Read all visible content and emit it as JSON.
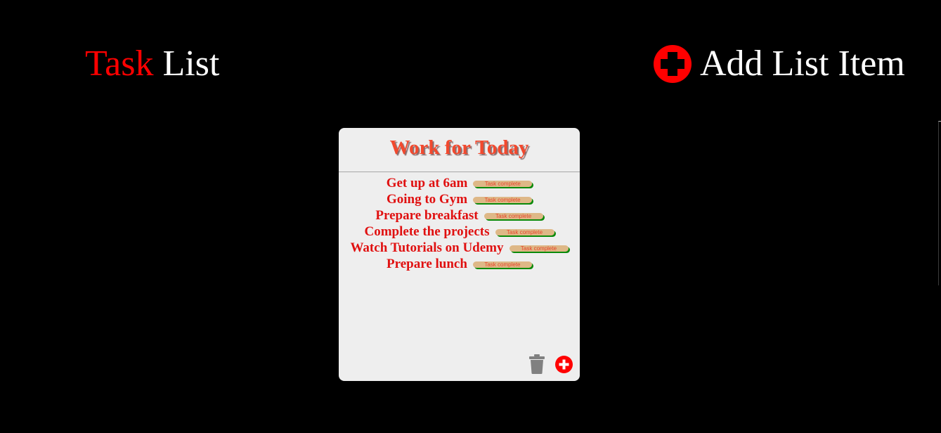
{
  "header": {
    "title_accent": "Task",
    "title_rest": "List",
    "add_list_label": "Add List Item",
    "add_list_icon": "plus-circle-icon"
  },
  "card": {
    "title": "Work for Today",
    "tasks": [
      {
        "text": "Get up at 6am",
        "button_label": "Task complete"
      },
      {
        "text": "Going to Gym",
        "button_label": "Task complete"
      },
      {
        "text": "Prepare breakfast",
        "button_label": "Task complete"
      },
      {
        "text": "Complete the projects",
        "button_label": "Task complete"
      },
      {
        "text": "Watch Tutorials on Udemy",
        "button_label": "Task complete"
      },
      {
        "text": "Prepare lunch",
        "button_label": "Task complete"
      }
    ],
    "actions": {
      "delete_icon": "trash-icon",
      "add_item_icon": "plus-circle-icon"
    }
  },
  "colors": {
    "background": "#000000",
    "accent_red": "#ff0000",
    "card_background": "#eeeeee",
    "card_title": "#f2492e",
    "task_text": "#e01010",
    "button_background": "#deb887",
    "button_shadow": "#0a8a0a",
    "trash_icon": "#808080"
  }
}
